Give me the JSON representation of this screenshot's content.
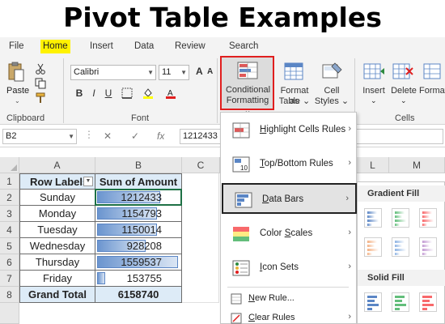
{
  "page_title": "Pivot Table Examples",
  "ribbon_tabs": [
    "File",
    "Home",
    "Insert",
    "Data",
    "Review",
    "Search"
  ],
  "clipboard": {
    "paste_label": "Paste",
    "group_label": "Clipboard"
  },
  "font": {
    "name": "Calibri",
    "size": "11",
    "group_label": "Font",
    "grow": "A",
    "shrink": "A",
    "bold": "B",
    "italic": "I",
    "underline": "U"
  },
  "styles": {
    "conditional_formatting": [
      "Conditional",
      "Formatting"
    ],
    "format_as_table": [
      "Format as",
      "Table"
    ],
    "cell_styles": [
      "Cell",
      "Styles"
    ]
  },
  "cells_group": {
    "insert": "Insert",
    "delete": "Delete",
    "format": "Format",
    "group_label": "Cells"
  },
  "formula_bar": {
    "name_box": "B2",
    "cancel": "✕",
    "enter": "✓",
    "fx": "fx",
    "value": "1212433"
  },
  "columns": [
    "A",
    "B",
    "C"
  ],
  "extra_columns": [
    "L",
    "M"
  ],
  "rows": [
    "1",
    "2",
    "3",
    "4",
    "5",
    "6",
    "7",
    "8"
  ],
  "table": {
    "header": [
      "Row Labels",
      "Sum of Amount"
    ],
    "data": [
      {
        "label": "Sunday",
        "value": "1212433",
        "bar": 0.78
      },
      {
        "label": "Monday",
        "value": "1154793",
        "bar": 0.74
      },
      {
        "label": "Tuesday",
        "value": "1150014",
        "bar": 0.74
      },
      {
        "label": "Wednesday",
        "value": "928208",
        "bar": 0.6
      },
      {
        "label": "Thursday",
        "value": "1559537",
        "bar": 1.0
      },
      {
        "label": "Friday",
        "value": "153755",
        "bar": 0.1
      }
    ],
    "total": {
      "label": "Grand Total",
      "value": "6158740"
    }
  },
  "cf_menu": {
    "items": [
      {
        "label": "Highlight Cells Rules",
        "underline": "H"
      },
      {
        "label": "Top/Bottom Rules",
        "underline": "T"
      },
      {
        "label": "Data Bars",
        "underline": "D"
      },
      {
        "label": "Color Scales",
        "underline": "S"
      },
      {
        "label": "Icon Sets",
        "underline": "I"
      }
    ],
    "small_items": [
      {
        "label": "New Rule...",
        "underline": "N"
      },
      {
        "label": "Clear Rules",
        "underline": "C"
      }
    ]
  },
  "data_bars_submenu": {
    "gradient_fill": "Gradient Fill",
    "solid_fill": "Solid Fill"
  },
  "colors": {
    "home_highlight": "#fff200",
    "cf_border": "#e01e1e",
    "table_header": "#ddebf7",
    "databar": "#6b95cf",
    "selection": "#1e7145"
  }
}
